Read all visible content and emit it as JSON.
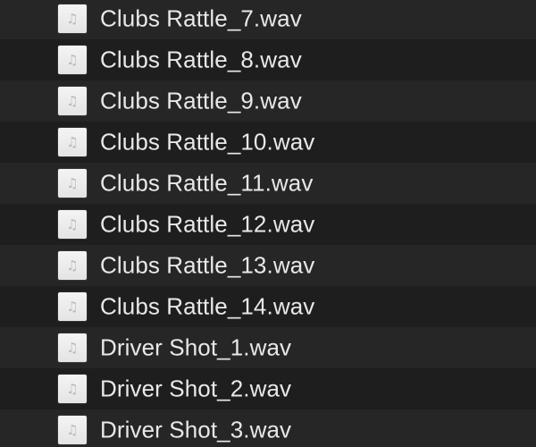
{
  "files": [
    {
      "name": "Clubs Rattle_7.wav",
      "icon": "audio-file-icon"
    },
    {
      "name": "Clubs Rattle_8.wav",
      "icon": "audio-file-icon"
    },
    {
      "name": "Clubs Rattle_9.wav",
      "icon": "audio-file-icon"
    },
    {
      "name": "Clubs Rattle_10.wav",
      "icon": "audio-file-icon"
    },
    {
      "name": "Clubs Rattle_11.wav",
      "icon": "audio-file-icon"
    },
    {
      "name": "Clubs Rattle_12.wav",
      "icon": "audio-file-icon"
    },
    {
      "name": "Clubs Rattle_13.wav",
      "icon": "audio-file-icon"
    },
    {
      "name": "Clubs Rattle_14.wav",
      "icon": "audio-file-icon"
    },
    {
      "name": "Driver Shot_1.wav",
      "icon": "audio-file-icon"
    },
    {
      "name": "Driver Shot_2.wav",
      "icon": "audio-file-icon"
    },
    {
      "name": "Driver Shot_3.wav",
      "icon": "audio-file-icon"
    }
  ],
  "icon_glyph": "♫",
  "colors": {
    "row_base": "#1e1e1e",
    "row_alt": "#262627",
    "text": "#e8e8e8",
    "icon_bg": "#f0f0f0"
  }
}
